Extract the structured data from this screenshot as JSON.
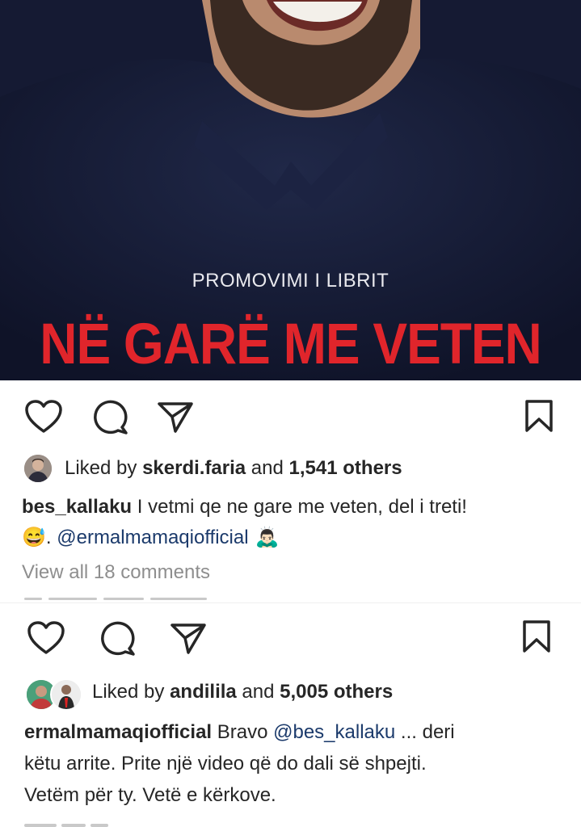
{
  "post1": {
    "image": {
      "promo_text": "PROMOVIMI I LIBRIT",
      "book_title": "NË GARË ME VETEN"
    },
    "actions": {
      "like_icon": "heart-outline-icon",
      "comment_icon": "comment-icon",
      "share_icon": "send-icon",
      "save_icon": "bookmark-icon"
    },
    "likes": {
      "prefix": "Liked by ",
      "user": "skerdi.faria",
      "middle": " and ",
      "count": "1,541 others"
    },
    "caption": {
      "username": "bes_kallaku",
      "text": " I vetmi qe ne gare me veten, del i treti!",
      "line2_emoji": "😅",
      "line2_sep": ". ",
      "mention": "@ermalmamaqiofficial",
      "line2_end_emoji": "🙇🏻‍♂️"
    },
    "view_comments": "View all 18 comments"
  },
  "post2": {
    "actions": {
      "like_icon": "heart-outline-icon",
      "comment_icon": "comment-icon",
      "share_icon": "send-icon",
      "save_icon": "bookmark-icon"
    },
    "likes": {
      "prefix": "Liked by ",
      "user": "andililа",
      "middle": " and ",
      "count": "5,005 others"
    },
    "caption": {
      "username": "ermalmamaqiofficial",
      "text_start": " Bravo ",
      "mention": "@bes_kallaku",
      "text_after_mention": " ... deri",
      "line2": "këtu arrite. Prite një video që do dali së shpejti.",
      "line3": "Vetëm për ty. Vetë e kërkove."
    }
  },
  "colors": {
    "title_red": "#e0252b",
    "mention_blue": "#1b3a6b",
    "muted_gray": "#8e8e8e"
  }
}
